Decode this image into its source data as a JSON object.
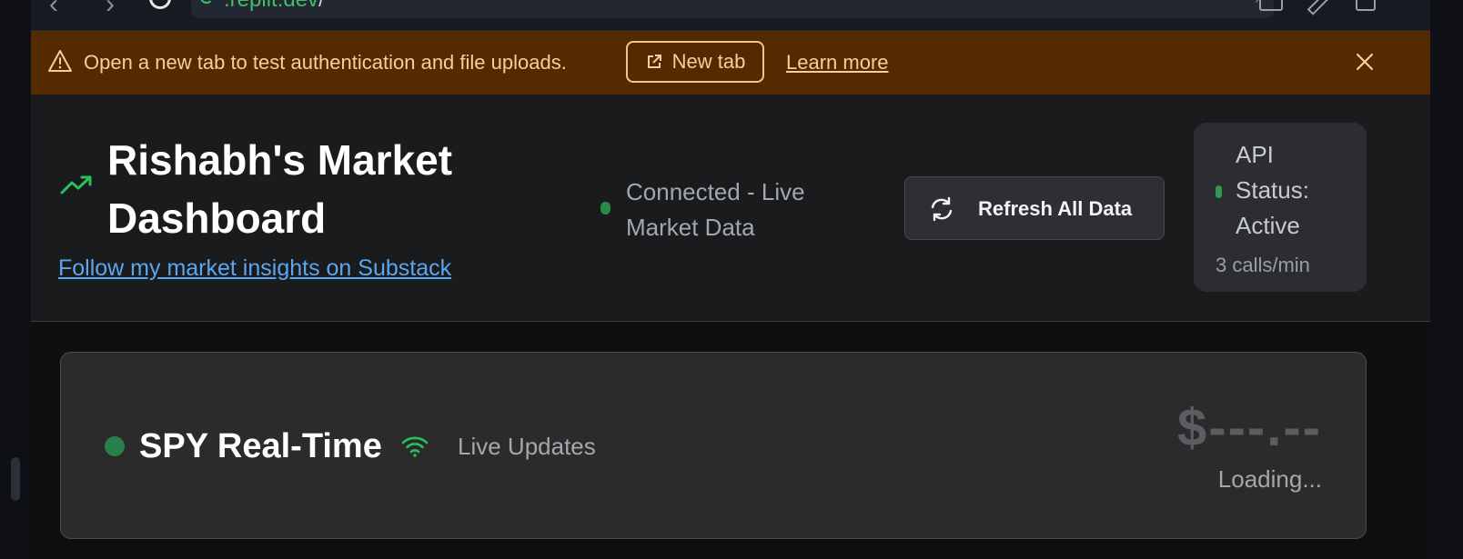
{
  "browser": {
    "url_host": ".replit.dev",
    "url_path": "/"
  },
  "banner": {
    "message": "Open a new tab to test authentication and file uploads.",
    "new_tab_label": "New tab",
    "learn_more_label": "Learn more"
  },
  "header": {
    "title": "Rishabh's Market Dashboard",
    "substack_link": "Follow my market insights on Substack",
    "connection_status": "Connected - Live Market Data",
    "refresh_label": "Refresh All Data",
    "api_status": "API Status: Active",
    "api_calls": "3 calls/min"
  },
  "spy_card": {
    "title": "SPY Real-Time",
    "live_label": "Live Updates",
    "price": "$---.--",
    "loading": "Loading..."
  },
  "colors": {
    "banner_bg": "#542b00",
    "banner_text": "#f6cf9a",
    "link_blue": "#5aa6f0",
    "status_green": "#2b9a4f",
    "accent_green": "#3fbf5f"
  },
  "icons": [
    "back-icon",
    "forward-icon",
    "reload-icon",
    "warning-icon",
    "external-link-icon",
    "close-icon",
    "trending-up-icon",
    "refresh-icon",
    "wifi-icon"
  ]
}
